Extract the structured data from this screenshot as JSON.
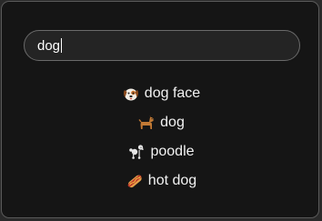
{
  "search": {
    "value": "dog"
  },
  "results": [
    {
      "label": "dog face",
      "icon": "dog-face-emoji"
    },
    {
      "label": "dog",
      "icon": "dog-emoji"
    },
    {
      "label": "poodle",
      "icon": "poodle-emoji"
    },
    {
      "label": "hot dog",
      "icon": "hot-dog-emoji"
    }
  ]
}
